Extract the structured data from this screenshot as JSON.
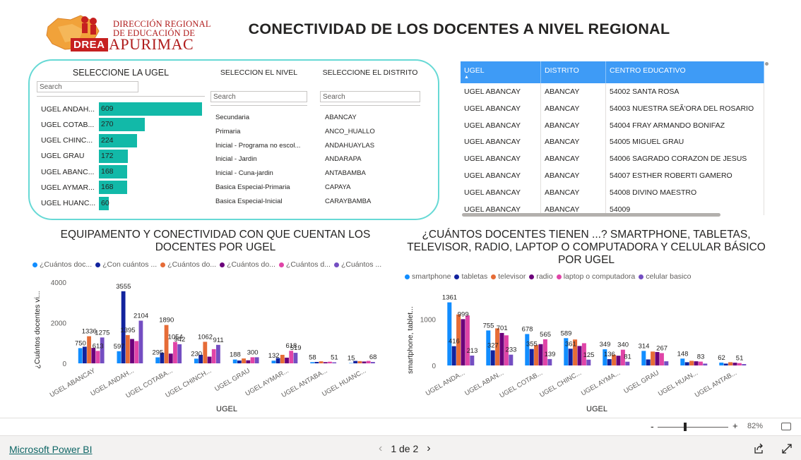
{
  "header": {
    "logo_line1": "DIRECCIÓN REGIONAL",
    "logo_line2": "DE EDUCACIÓN DE",
    "logo_badge": "DREA",
    "logo_line3": "APURIMAC",
    "title": "CONECTIVIDAD DE LOS DOCENTES A NIVEL REGIONAL"
  },
  "slicers": {
    "ugel": {
      "title": "SELECCIONE LA UGEL",
      "search": "Search",
      "items": [
        {
          "label": "UGEL ANDAH...",
          "value": 609
        },
        {
          "label": "UGEL COTAB...",
          "value": 270
        },
        {
          "label": "UGEL CHINC...",
          "value": 224
        },
        {
          "label": "UGEL GRAU",
          "value": 172
        },
        {
          "label": "UGEL ABANC...",
          "value": 168
        },
        {
          "label": "UGEL AYMAR...",
          "value": 168
        },
        {
          "label": "UGEL HUANC...",
          "value": 60
        }
      ]
    },
    "nivel": {
      "title": "SELECCION EL NIVEL",
      "search": "Search",
      "items": [
        "Secundaria",
        "Primaria",
        "Inicial - Programa no escol...",
        "Inicial - Jardin",
        "Inicial - Cuna-jardin",
        "Basica Especial-Primaria",
        "Basica Especial-Inicial"
      ]
    },
    "distrito": {
      "title": "SELECCIONE EL DISTRITO",
      "search": "Search",
      "items": [
        "ABANCAY",
        "ANCO_HUALLO",
        "ANDAHUAYLAS",
        "ANDARAPA",
        "ANTABAMBA",
        "CAPAYA",
        "CARAYBAMBA"
      ]
    }
  },
  "table": {
    "headers": [
      "UGEL",
      "DISTRITO",
      "CENTRO EDUCATIVO"
    ],
    "rows": [
      [
        "UGEL ABANCAY",
        "ABANCAY",
        "54002 SANTA ROSA"
      ],
      [
        "UGEL ABANCAY",
        "ABANCAY",
        "54003 NUESTRA SEÃ'ORA DEL ROSARIO"
      ],
      [
        "UGEL ABANCAY",
        "ABANCAY",
        "54004 FRAY ARMANDO BONIFAZ"
      ],
      [
        "UGEL ABANCAY",
        "ABANCAY",
        "54005 MIGUEL GRAU"
      ],
      [
        "UGEL ABANCAY",
        "ABANCAY",
        "54006 SAGRADO CORAZON DE JESUS"
      ],
      [
        "UGEL ABANCAY",
        "ABANCAY",
        "54007 ESTHER ROBERTI GAMERO"
      ],
      [
        "UGEL ABANCAY",
        "ABANCAY",
        "54008 DIVINO MAESTRO"
      ],
      [
        "UGEL ABANCAY",
        "ABANCAY",
        "54009"
      ]
    ]
  },
  "chart_data": [
    {
      "type": "bar",
      "title": "EQUIPAMENTO Y CONECTIVIDAD CON QUE CUENTAN LOS DOCENTES POR UGEL",
      "xlabel": "UGEL",
      "ylabel": "¿Cuántos docentes vi...",
      "ylim": [
        0,
        4000
      ],
      "yticks": [
        0,
        2000,
        4000
      ],
      "categories": [
        "UGEL ABANCAY",
        "UGEL ANDAH...",
        "UGEL COTABA...",
        "UGEL CHINCH...",
        "UGEL GRAU",
        "UGEL AYMAR...",
        "UGEL ANTABA...",
        "UGEL HUANC..."
      ],
      "series": [
        {
          "name": "¿Cuántos doc...",
          "color": "#118dff",
          "values": [
            750,
            597,
            295,
            230,
            188,
            132,
            58,
            15
          ]
        },
        {
          "name": "¿Con cuántos ...",
          "color": "#12239e",
          "values": [
            820,
            3555,
            520,
            420,
            140,
            260,
            70,
            120
          ]
        },
        {
          "name": "¿Cuántos do...",
          "color": "#e66c37",
          "values": [
            1336,
            1395,
            1890,
            1062,
            240,
            420,
            100,
            110
          ]
        },
        {
          "name": "¿Cuántos do...",
          "color": "#6b007b",
          "values": [
            760,
            1200,
            480,
            330,
            150,
            280,
            60,
            90
          ]
        },
        {
          "name": "¿Cuántos d...",
          "color": "#e044a7",
          "values": [
            613,
            1100,
            1054,
            700,
            300,
            618,
            80,
            120
          ]
        },
        {
          "name": "¿Cuántos ...",
          "color": "#744ec2",
          "values": [
            1275,
            2104,
            942,
            911,
            300,
            519,
            51,
            68
          ]
        }
      ],
      "data_labels": [
        {
          "cat": 0,
          "text": "750",
          "value": 750
        },
        {
          "cat": 0,
          "text": "1336",
          "value": 1336
        },
        {
          "cat": 0,
          "text": "613",
          "value": 613
        },
        {
          "cat": 0,
          "text": "1275",
          "value": 1275
        },
        {
          "cat": 1,
          "text": "597",
          "value": 597
        },
        {
          "cat": 1,
          "text": "3555",
          "value": 3555
        },
        {
          "cat": 1,
          "text": "1395",
          "value": 1395
        },
        {
          "cat": 1,
          "text": "2104",
          "value": 2104
        },
        {
          "cat": 2,
          "text": "295",
          "value": 295
        },
        {
          "cat": 2,
          "text": "1890",
          "value": 1890
        },
        {
          "cat": 2,
          "text": "1054",
          "value": 1054
        },
        {
          "cat": 2,
          "text": "942",
          "value": 942
        },
        {
          "cat": 3,
          "text": "230",
          "value": 230
        },
        {
          "cat": 3,
          "text": "1062",
          "value": 1062
        },
        {
          "cat": 3,
          "text": "911",
          "value": 911
        },
        {
          "cat": 4,
          "text": "188",
          "value": 188
        },
        {
          "cat": 4,
          "text": "300",
          "value": 300
        },
        {
          "cat": 5,
          "text": "132",
          "value": 132
        },
        {
          "cat": 5,
          "text": "618",
          "value": 618
        },
        {
          "cat": 5,
          "text": "519",
          "value": 519
        },
        {
          "cat": 6,
          "text": "58",
          "value": 58
        },
        {
          "cat": 6,
          "text": "51",
          "value": 51
        },
        {
          "cat": 7,
          "text": "15",
          "value": 15
        },
        {
          "cat": 7,
          "text": "68",
          "value": 68
        }
      ]
    },
    {
      "type": "bar",
      "title": "¿CUÁNTOS DOCENTES TIENEN ...? SMARTPHONE, TABLETAS, TELEVISOR, RADIO, LAPTOP O COMPUTADORA Y CELULAR BÁSICO POR UGEL",
      "xlabel": "UGEL",
      "ylabel": "smartphone, tablet...",
      "ylim": [
        0,
        1400
      ],
      "yticks": [
        0,
        1000
      ],
      "categories": [
        "UGEL ANDA...",
        "UGEL ABAN...",
        "UGEL COTAB...",
        "UGEL CHINC...",
        "UGEL AYMA...",
        "UGEL GRAU",
        "UGEL HUAN...",
        "UGEL ANTAB..."
      ],
      "series": [
        {
          "name": "smartphone",
          "color": "#118dff",
          "values": [
            1361,
            755,
            678,
            589,
            349,
            314,
            148,
            62
          ]
        },
        {
          "name": "tabletas",
          "color": "#12239e",
          "values": [
            416,
            327,
            355,
            361,
            136,
            130,
            70,
            40
          ]
        },
        {
          "name": "televisor",
          "color": "#e66c37",
          "values": [
            1100,
            800,
            440,
            560,
            230,
            300,
            100,
            70
          ]
        },
        {
          "name": "radio",
          "color": "#6b007b",
          "values": [
            999,
            701,
            460,
            420,
            210,
            290,
            90,
            60
          ]
        },
        {
          "name": "laptop o computadora",
          "color": "#e044a7",
          "values": [
            1080,
            650,
            565,
            480,
            340,
            267,
            83,
            51
          ]
        },
        {
          "name": "celular basico",
          "color": "#744ec2",
          "values": [
            213,
            233,
            139,
            125,
            81,
            90,
            40,
            30
          ]
        }
      ],
      "data_labels": [
        {
          "cat": 0,
          "text": "1361",
          "value": 1361
        },
        {
          "cat": 0,
          "text": "416",
          "value": 416
        },
        {
          "cat": 0,
          "text": "999",
          "value": 999
        },
        {
          "cat": 0,
          "text": "213",
          "value": 213
        },
        {
          "cat": 1,
          "text": "755",
          "value": 755
        },
        {
          "cat": 1,
          "text": "327",
          "value": 327
        },
        {
          "cat": 1,
          "text": "701",
          "value": 701
        },
        {
          "cat": 1,
          "text": "233",
          "value": 233
        },
        {
          "cat": 2,
          "text": "678",
          "value": 678
        },
        {
          "cat": 2,
          "text": "355",
          "value": 355
        },
        {
          "cat": 2,
          "text": "565",
          "value": 565
        },
        {
          "cat": 2,
          "text": "139",
          "value": 139
        },
        {
          "cat": 3,
          "text": "589",
          "value": 589
        },
        {
          "cat": 3,
          "text": "361",
          "value": 361
        },
        {
          "cat": 3,
          "text": "125",
          "value": 125
        },
        {
          "cat": 4,
          "text": "349",
          "value": 349
        },
        {
          "cat": 4,
          "text": "136",
          "value": 136
        },
        {
          "cat": 4,
          "text": "340",
          "value": 340
        },
        {
          "cat": 4,
          "text": "81",
          "value": 81
        },
        {
          "cat": 5,
          "text": "314",
          "value": 314
        },
        {
          "cat": 5,
          "text": "267",
          "value": 267
        },
        {
          "cat": 6,
          "text": "148",
          "value": 148
        },
        {
          "cat": 6,
          "text": "83",
          "value": 83
        },
        {
          "cat": 7,
          "text": "62",
          "value": 62
        },
        {
          "cat": 7,
          "text": "51",
          "value": 51
        }
      ]
    }
  ],
  "footer": {
    "zoom": "82%",
    "zoom_minus": "-",
    "zoom_plus": "+",
    "brand": "Microsoft Power BI",
    "page_indicator": "1 de 2",
    "prev": "‹",
    "next": "›"
  }
}
